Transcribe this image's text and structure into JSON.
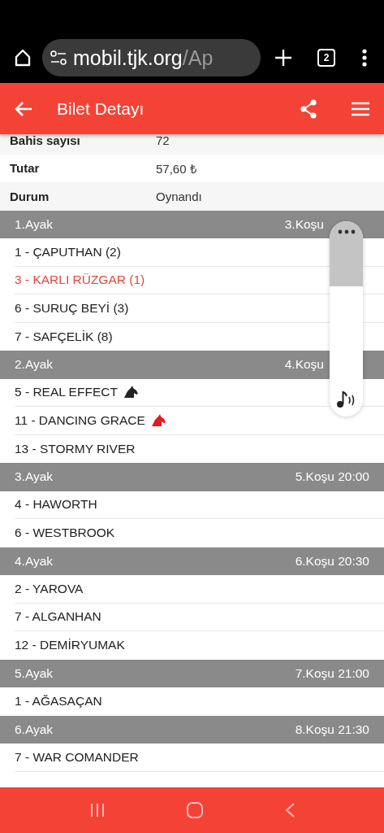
{
  "browser": {
    "url_host": "mobil.tjk.org",
    "url_path": "/Ap",
    "tab_count": "2"
  },
  "header": {
    "title": "Bilet Detayı"
  },
  "info": [
    {
      "label": "Bahis sayısı",
      "value": "72"
    },
    {
      "label": "Tutar",
      "value": "57,60 ₺"
    },
    {
      "label": "Durum",
      "value": "Oynandı"
    }
  ],
  "legs": [
    {
      "title": "1.Ayak",
      "race": "3.Koşu",
      "horses": [
        {
          "name": "1 - ÇAPUTHAN (2)",
          "winner": false
        },
        {
          "name": "3 - KARLI RÜZGAR (1)",
          "winner": true
        },
        {
          "name": "6 - SURUÇ BEYİ (3)",
          "winner": false
        },
        {
          "name": "7 - SAFÇELİK (8)",
          "winner": false
        }
      ]
    },
    {
      "title": "2.Ayak",
      "race": "4.Koşu",
      "horses": [
        {
          "name": "5 - REAL EFFECT",
          "winner": false,
          "color": "#222222"
        },
        {
          "name": "11 - DANCING GRACE",
          "winner": false,
          "color": "#e8191e"
        },
        {
          "name": "13 - STORMY RIVER",
          "winner": false
        }
      ]
    },
    {
      "title": "3.Ayak",
      "race": "5.Koşu 20:00",
      "horses": [
        {
          "name": "4 - HAWORTH",
          "winner": false
        },
        {
          "name": "6 - WESTBROOK",
          "winner": false
        }
      ]
    },
    {
      "title": "4.Ayak",
      "race": "6.Koşu 20:30",
      "horses": [
        {
          "name": "2 - YAROVA",
          "winner": false
        },
        {
          "name": "7 - ALGANHAN",
          "winner": false
        },
        {
          "name": "12 - DEMİRYUMAK",
          "winner": false
        }
      ]
    },
    {
      "title": "5.Ayak",
      "race": "7.Koşu 21:00",
      "horses": [
        {
          "name": "1 - AĞASAÇAN",
          "winner": false
        }
      ]
    },
    {
      "title": "6.Ayak",
      "race": "8.Koşu 21:30",
      "horses": [
        {
          "name": "7 - WAR COMANDER",
          "winner": false
        }
      ]
    }
  ]
}
